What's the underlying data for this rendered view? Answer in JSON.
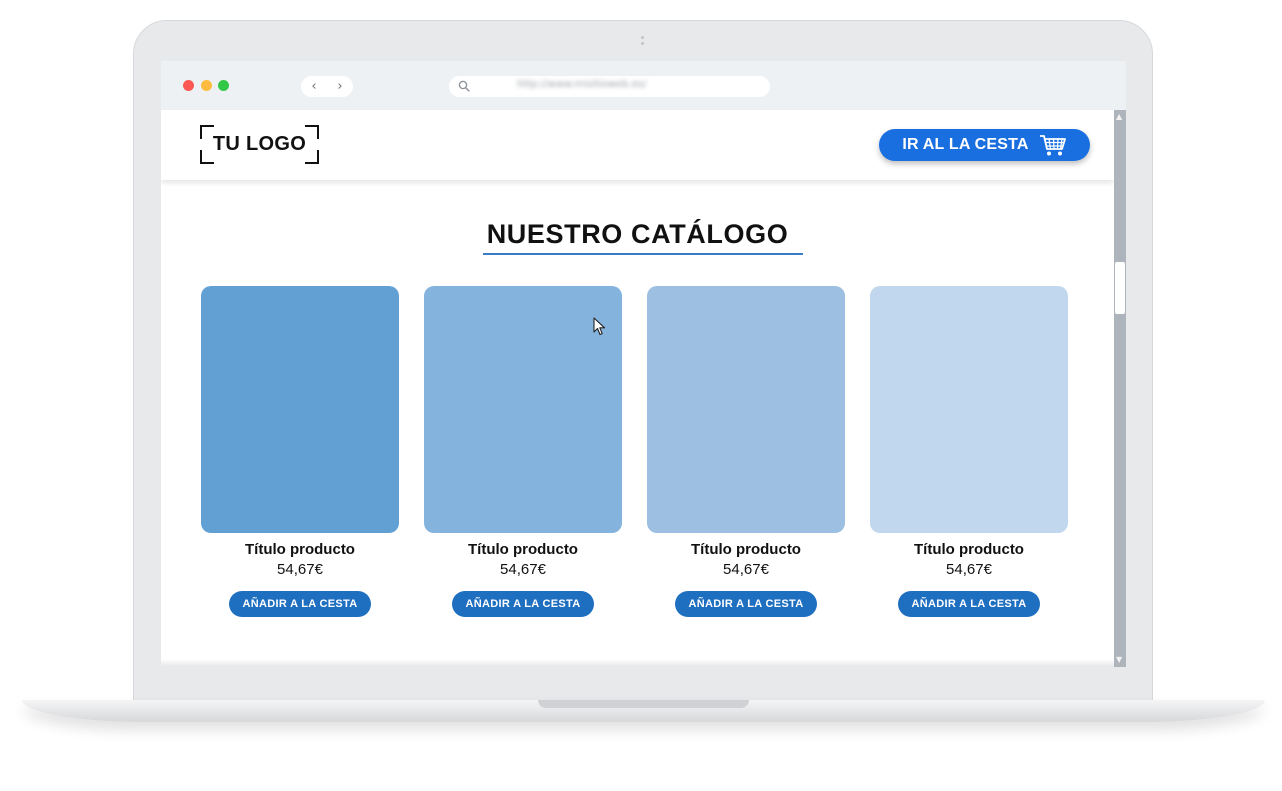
{
  "browser": {
    "url": "http://www.misitioweb.es/",
    "back_glyph": "‹",
    "forward_glyph": "›"
  },
  "header": {
    "logo_text": "TU LOGO",
    "cart_button_label": "IR AL LA CESTA"
  },
  "catalog": {
    "title": "NUESTRO CATÁLOGO",
    "products": [
      {
        "title": "Título producto",
        "price": "54,67€",
        "button": "AÑADIR A LA CESTA",
        "color": "#629fd3"
      },
      {
        "title": "Título producto",
        "price": "54,67€",
        "button": "AÑADIR A LA CESTA",
        "color": "#84b3dd"
      },
      {
        "title": "Título producto",
        "price": "54,67€",
        "button": "AÑADIR A LA CESTA",
        "color": "#9cbfe2"
      },
      {
        "title": "Título producto",
        "price": "54,67€",
        "button": "AÑADIR A LA CESTA",
        "color": "#c0d7ee"
      }
    ]
  },
  "scrollbar": {
    "up_glyph": "▲",
    "down_glyph": "▼"
  },
  "colors": {
    "accent": "#1a6fe0",
    "button_blue": "#1f6fc1",
    "underline": "#3a7bc8"
  }
}
